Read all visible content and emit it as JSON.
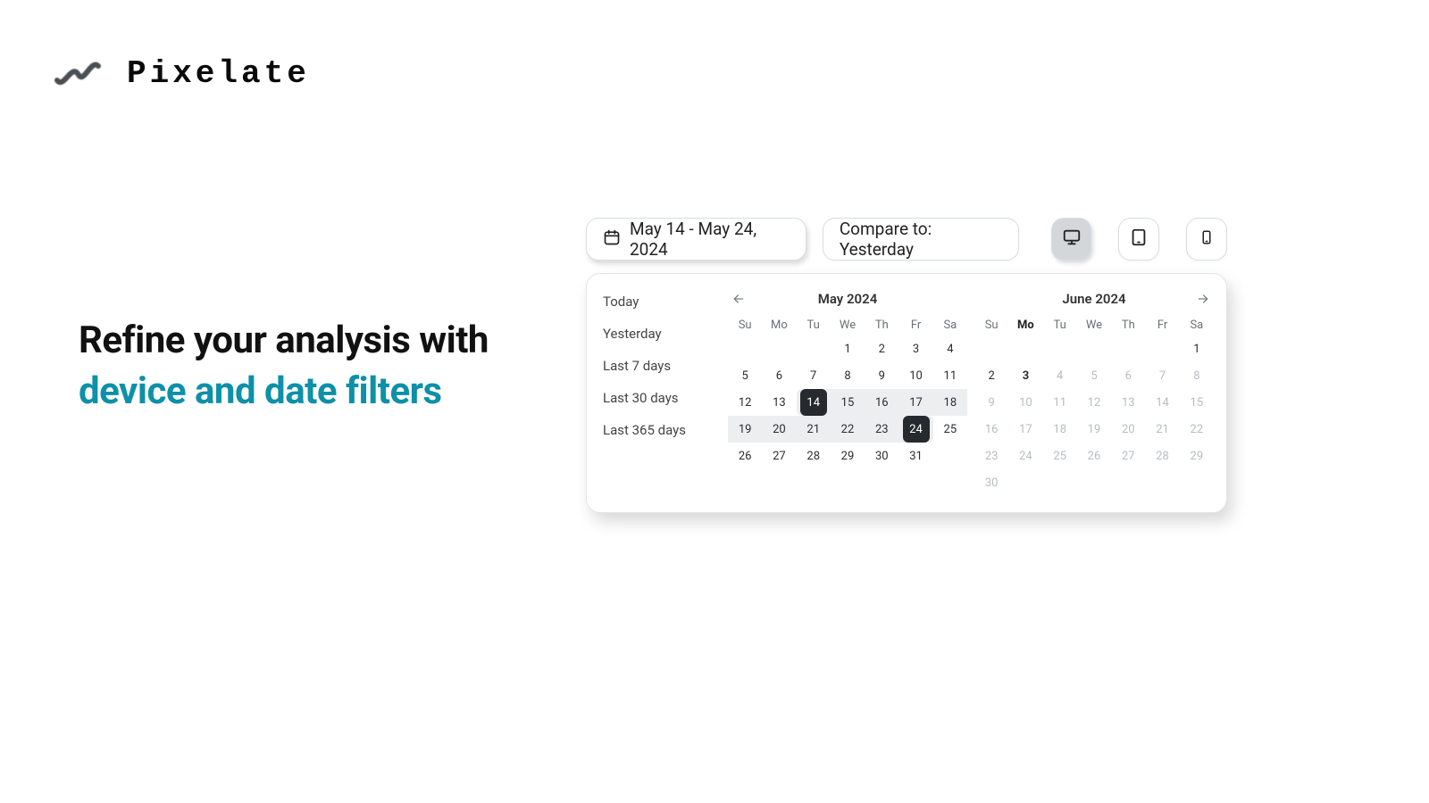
{
  "brand": {
    "name": "Pixelate"
  },
  "headline": {
    "line1": "Refine your analysis with",
    "line2": "device and date filters"
  },
  "toolbar": {
    "date_range_label": "May 14 - May 24, 2024",
    "compare_label": "Compare to: Yesterday"
  },
  "device_selector": {
    "options": [
      "desktop",
      "tablet",
      "mobile"
    ],
    "active": "desktop"
  },
  "presets": [
    "Today",
    "Yesterday",
    "Last 7 days",
    "Last 30 days",
    "Last 365 days"
  ],
  "calendar": {
    "range": {
      "start_value": 14,
      "end_value": 24
    },
    "months": [
      {
        "title": "May 2024",
        "nav": "left",
        "dow": [
          "Su",
          "Mo",
          "Tu",
          "We",
          "Th",
          "Fr",
          "Sa"
        ],
        "bold_dow": [],
        "weeks": [
          [
            null,
            null,
            null,
            1,
            2,
            3,
            4
          ],
          [
            5,
            6,
            7,
            8,
            9,
            10,
            11
          ],
          [
            12,
            13,
            14,
            15,
            16,
            17,
            18
          ],
          [
            19,
            20,
            21,
            22,
            23,
            24,
            25
          ],
          [
            26,
            27,
            28,
            29,
            30,
            31,
            null
          ]
        ],
        "range_month": true
      },
      {
        "title": "June 2024",
        "nav": "right",
        "dow": [
          "Su",
          "Mo",
          "Tu",
          "We",
          "Th",
          "Fr",
          "Sa"
        ],
        "bold_dow": [
          "Mo"
        ],
        "weeks": [
          [
            null,
            null,
            null,
            null,
            null,
            null,
            1
          ],
          [
            2,
            3,
            4,
            5,
            6,
            7,
            8
          ],
          [
            9,
            10,
            11,
            12,
            13,
            14,
            15
          ],
          [
            16,
            17,
            18,
            19,
            20,
            21,
            22
          ],
          [
            23,
            24,
            25,
            26,
            27,
            28,
            29
          ],
          [
            30,
            null,
            null,
            null,
            null,
            null,
            null
          ]
        ],
        "other_from": 4,
        "bold_days": [
          3
        ],
        "range_month": false
      }
    ]
  }
}
